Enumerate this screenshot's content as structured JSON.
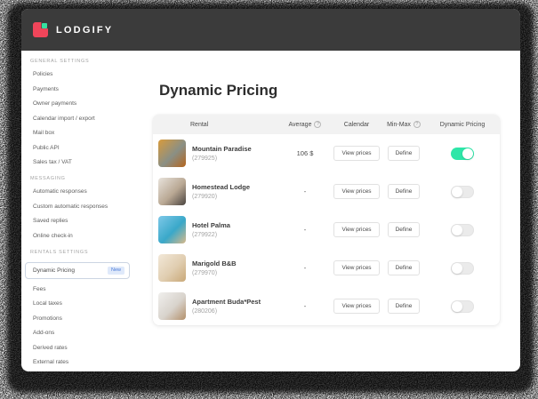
{
  "header": {
    "brand": "LODGIFY"
  },
  "page": {
    "title": "Dynamic Pricing"
  },
  "sidebar": {
    "sections": [
      {
        "label": "GENERAL SETTINGS",
        "items": [
          "Policies",
          "Payments",
          "Owner payments",
          "Calendar import / export",
          "Mail box",
          "Public API",
          "Sales tax / VAT"
        ]
      },
      {
        "label": "MESSAGING",
        "items": [
          "Automatic responses",
          "Custom automatic responses",
          "Saved replies",
          "Online check-in"
        ]
      },
      {
        "label": "RENTALS SETTINGS",
        "items": [
          "Dynamic Pricing",
          "Fees",
          "Local taxes",
          "Promotions",
          "Add-ons",
          "Derived rates",
          "External rates"
        ],
        "selected": "Dynamic Pricing",
        "badge": "New"
      }
    ]
  },
  "table": {
    "columns": {
      "rental": "Rental",
      "average": "Average",
      "calendar": "Calendar",
      "min_max": "Min-Max",
      "dynamic_pricing": "Dynamic Pricing"
    },
    "help_glyph": "?",
    "view_prices_label": "View prices",
    "define_label": "Define"
  },
  "rentals": [
    {
      "name": "Mountain Paradise",
      "id": "(279925)",
      "average": "106 $",
      "dynamic_pricing_enabled": true,
      "thumb_colors": [
        "#d89b3c",
        "#8a8f85",
        "#b5651d"
      ]
    },
    {
      "name": "Homestead Lodge",
      "id": "(279920)",
      "average": "-",
      "dynamic_pricing_enabled": false,
      "thumb_colors": [
        "#e8e3dc",
        "#b9a894",
        "#4a4440"
      ]
    },
    {
      "name": "Hotel Palma",
      "id": "(279922)",
      "average": "-",
      "dynamic_pricing_enabled": false,
      "thumb_colors": [
        "#7ec8e8",
        "#3aa8c9",
        "#d9b98a"
      ]
    },
    {
      "name": "Marigold B&B",
      "id": "(279970)",
      "average": "-",
      "dynamic_pricing_enabled": false,
      "thumb_colors": [
        "#f2e8d8",
        "#e0cdb0",
        "#c9a878"
      ]
    },
    {
      "name": "Apartment Buda*Pest",
      "id": "(280206)",
      "average": "-",
      "dynamic_pricing_enabled": false,
      "thumb_colors": [
        "#f0efed",
        "#d8d3cc",
        "#b3906b"
      ]
    }
  ],
  "colors": {
    "topbar": "#3b3b3b",
    "brand_red": "#f0455a",
    "brand_teal": "#35e0a1",
    "accent_toggle_on": "#2ee6a8",
    "badge_blue": "#4a7bd8"
  }
}
